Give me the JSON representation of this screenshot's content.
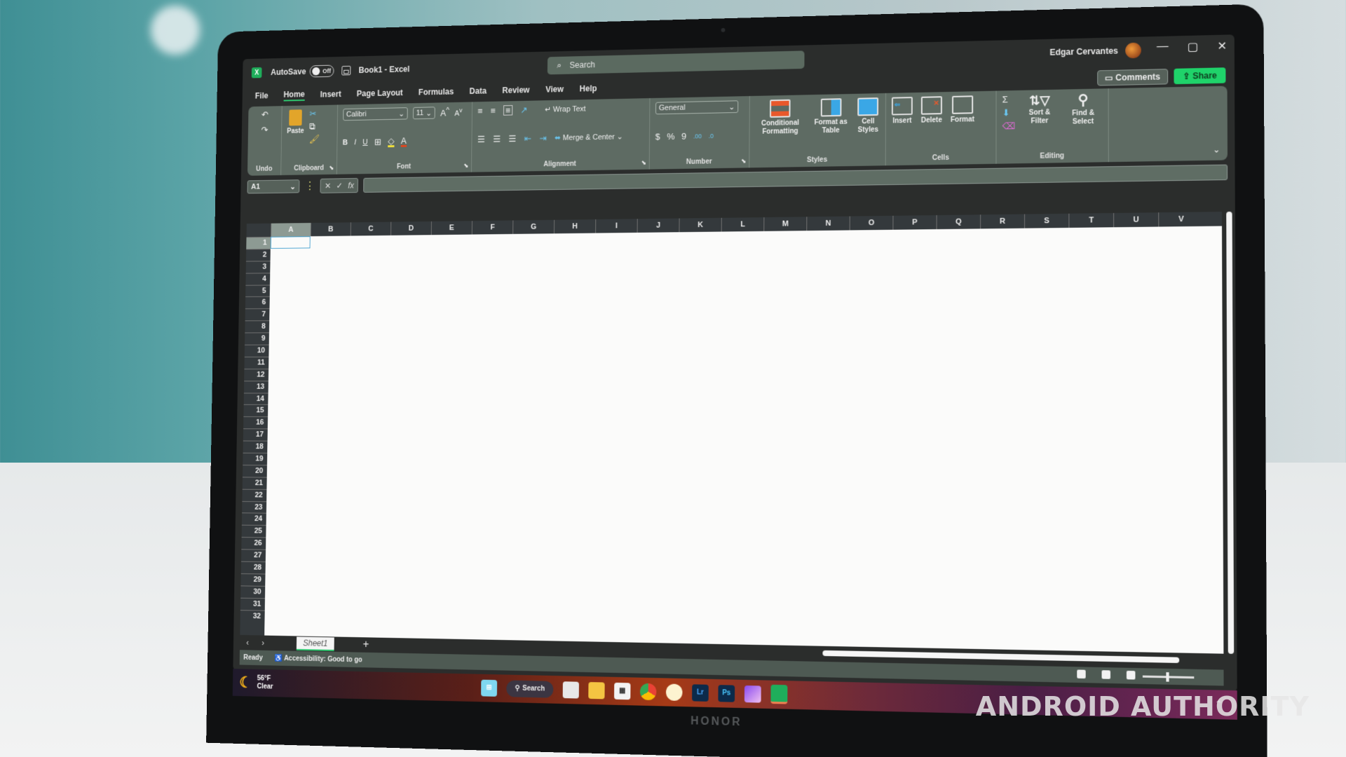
{
  "titlebar": {
    "app_icon": "excel-icon",
    "autosave_label": "AutoSave",
    "autosave_state": "Off",
    "document_title": "Book1 - Excel",
    "search_placeholder": "Search",
    "user_name": "Edgar Cervantes",
    "minimize": "—",
    "restore": "▢",
    "close": "✕"
  },
  "actions": {
    "comments_label": "Comments",
    "share_label": "Share"
  },
  "tabs": [
    {
      "label": "File",
      "active": false
    },
    {
      "label": "Home",
      "active": true
    },
    {
      "label": "Insert",
      "active": false
    },
    {
      "label": "Page Layout",
      "active": false
    },
    {
      "label": "Formulas",
      "active": false
    },
    {
      "label": "Data",
      "active": false
    },
    {
      "label": "Review",
      "active": false
    },
    {
      "label": "View",
      "active": false
    },
    {
      "label": "Help",
      "active": false
    }
  ],
  "ribbon": {
    "undo": {
      "label": "Undo"
    },
    "clipboard": {
      "label": "Clipboard",
      "paste": "Paste"
    },
    "font": {
      "label": "Font",
      "font_name": "Calibri",
      "font_size": "11",
      "bold": "B",
      "italic": "I",
      "underline": "U",
      "fill_color": "#f2e23a",
      "font_color": "#e0451d"
    },
    "alignment": {
      "label": "Alignment",
      "wrap_text": "Wrap Text",
      "merge_center": "Merge & Center"
    },
    "number": {
      "label": "Number",
      "format": "General",
      "currency": "$",
      "percent": "%",
      "comma": "9",
      "inc_decimal": ".00",
      "dec_decimal": ".0"
    },
    "styles": {
      "label": "Styles",
      "conditional_formatting": "Conditional Formatting",
      "format_as_table": "Format as Table",
      "cell_styles": "Cell Styles"
    },
    "cells": {
      "label": "Cells",
      "insert": "Insert",
      "delete": "Delete",
      "format": "Format"
    },
    "editing": {
      "label": "Editing",
      "autosum": "Σ",
      "sort_filter": "Sort & Filter",
      "find_select": "Find & Select"
    }
  },
  "formula_bar": {
    "name_box": "A1",
    "cancel": "✕",
    "enter": "✓",
    "fx": "fx",
    "formula": ""
  },
  "grid": {
    "columns": [
      "A",
      "B",
      "C",
      "D",
      "E",
      "F",
      "G",
      "H",
      "I",
      "J",
      "K",
      "L",
      "M",
      "N",
      "O",
      "P",
      "Q",
      "R",
      "S",
      "T",
      "U",
      "V"
    ],
    "rows": [
      "1",
      "2",
      "3",
      "4",
      "5",
      "6",
      "7",
      "8",
      "9",
      "10",
      "11",
      "12",
      "13",
      "14",
      "15",
      "16",
      "17",
      "18",
      "19",
      "20",
      "21",
      "22",
      "23",
      "24",
      "25",
      "26",
      "27",
      "28",
      "29",
      "30",
      "31",
      "32"
    ],
    "selected_cell": "A1"
  },
  "sheets": {
    "prev": "‹",
    "next": "›",
    "tabs": [
      "Sheet1"
    ],
    "add": "+"
  },
  "status": {
    "ready": "Ready",
    "accessibility": "Accessibility: Good to go"
  },
  "taskbar": {
    "temperature": "56°F",
    "condition": "Clear",
    "search_label": "Search",
    "apps": [
      "start",
      "search",
      "task-view",
      "file-explorer",
      "store",
      "chrome",
      "photos",
      "lightroom",
      "photoshop",
      "onenote",
      "excel"
    ],
    "lightroom_label": "Lr",
    "photoshop_label": "Ps"
  },
  "device": {
    "brand": "HONOR"
  },
  "watermark": "ANDROID AUTHORITY"
}
